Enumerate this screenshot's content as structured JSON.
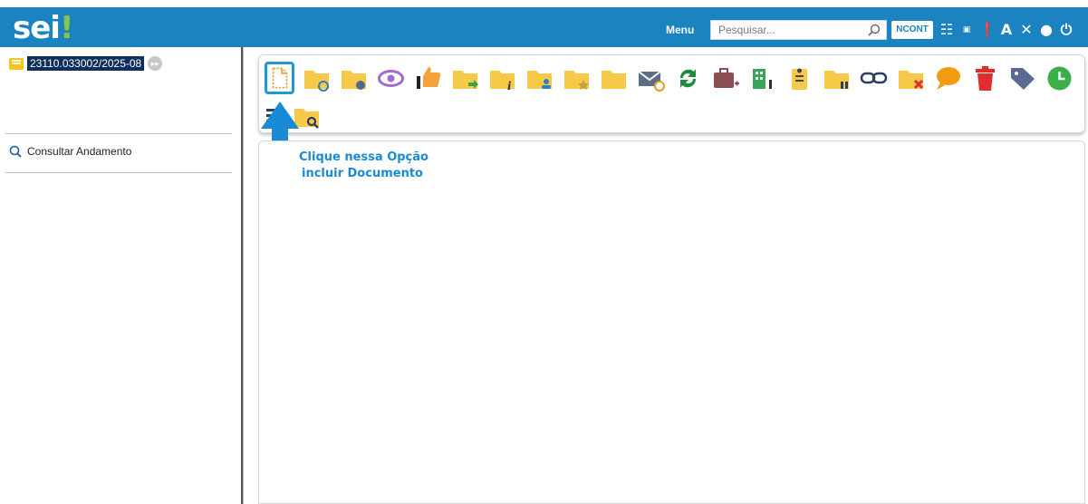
{
  "header": {
    "logo_text": "sei",
    "logo_bang": "!",
    "menu_label": "Menu",
    "search_placeholder": "Pesquisar...",
    "unit_label": "NCONT",
    "top_icons": [
      "list-view-icon",
      "numeric-icon",
      "alert-icon",
      "font-size-icon",
      "tools-icon",
      "user-icon",
      "power-icon"
    ]
  },
  "sidebar": {
    "process_number": "23110.033002/2025-08",
    "consult_label": "Consultar Andamento"
  },
  "toolbar": {
    "buttons_row1": [
      "incluir-documento-icon",
      "folder-sync-icon",
      "folder-group-settings-icon",
      "eye-icon",
      "thumbs-up-icon",
      "folder-send-icon",
      "folder-info-icon",
      "folder-user-icon",
      "folder-star-icon",
      "folder-icon",
      "email-icon",
      "sync-icon",
      "briefcase-add-icon",
      "building-icon",
      "clipboard-icon",
      "folder-pause-icon",
      "link-icon",
      "folder-close-icon",
      "comment-icon",
      "trash-icon",
      "tag-icon",
      "clock-icon"
    ],
    "buttons_row2": [
      "list-icon",
      "folder-search-icon"
    ]
  },
  "annotation": {
    "line1": "Clique nessa Opção",
    "line2": "incluir Documento"
  },
  "colors": {
    "header_bg": "#1b84c0",
    "accent_green": "#8bc34a",
    "folder_yellow": "#f7c948",
    "annotation_blue": "#1b8ad6"
  }
}
